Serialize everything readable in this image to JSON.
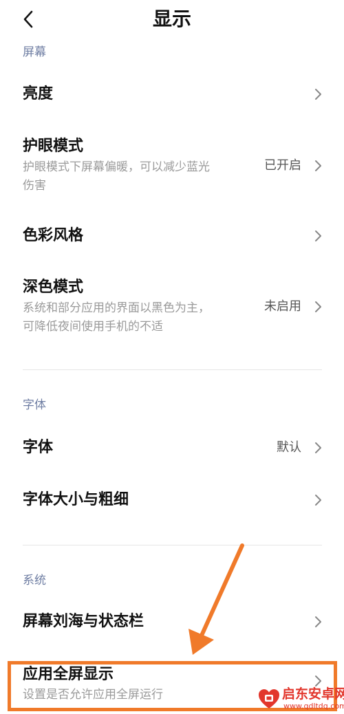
{
  "header": {
    "title": "显示",
    "back_icon": "chevron-left-icon"
  },
  "sections": [
    {
      "title": "屏幕",
      "items": [
        {
          "title": "亮度"
        },
        {
          "title": "护眼模式",
          "desc_lines": [
            "护眼模式下屏幕偏暖，可以减少蓝光",
            "伤害"
          ],
          "value": "已开启"
        },
        {
          "title": "色彩风格"
        },
        {
          "title": "深色模式",
          "desc_lines": [
            "系统和部分应用的界面以黑色为主，",
            "可降低夜间使用手机的不适"
          ],
          "value": "未启用"
        }
      ]
    },
    {
      "title": "字体",
      "items": [
        {
          "title": "字体",
          "value": "默认"
        },
        {
          "title": "字体大小与粗细"
        }
      ]
    },
    {
      "title": "系统",
      "items": [
        {
          "title": "屏幕刘海与状态栏"
        },
        {
          "title": "应用全屏显示",
          "desc_lines": [
            "设置是否允许应用全屏运行"
          ]
        }
      ]
    }
  ],
  "annotation": {
    "color": "#f07a2a",
    "highlight": "应用全屏显示"
  },
  "watermark": {
    "name": "启东安卓网",
    "url": "www.qdltdq.com"
  },
  "icons": {
    "row_arrow": "chevron-right-icon"
  }
}
